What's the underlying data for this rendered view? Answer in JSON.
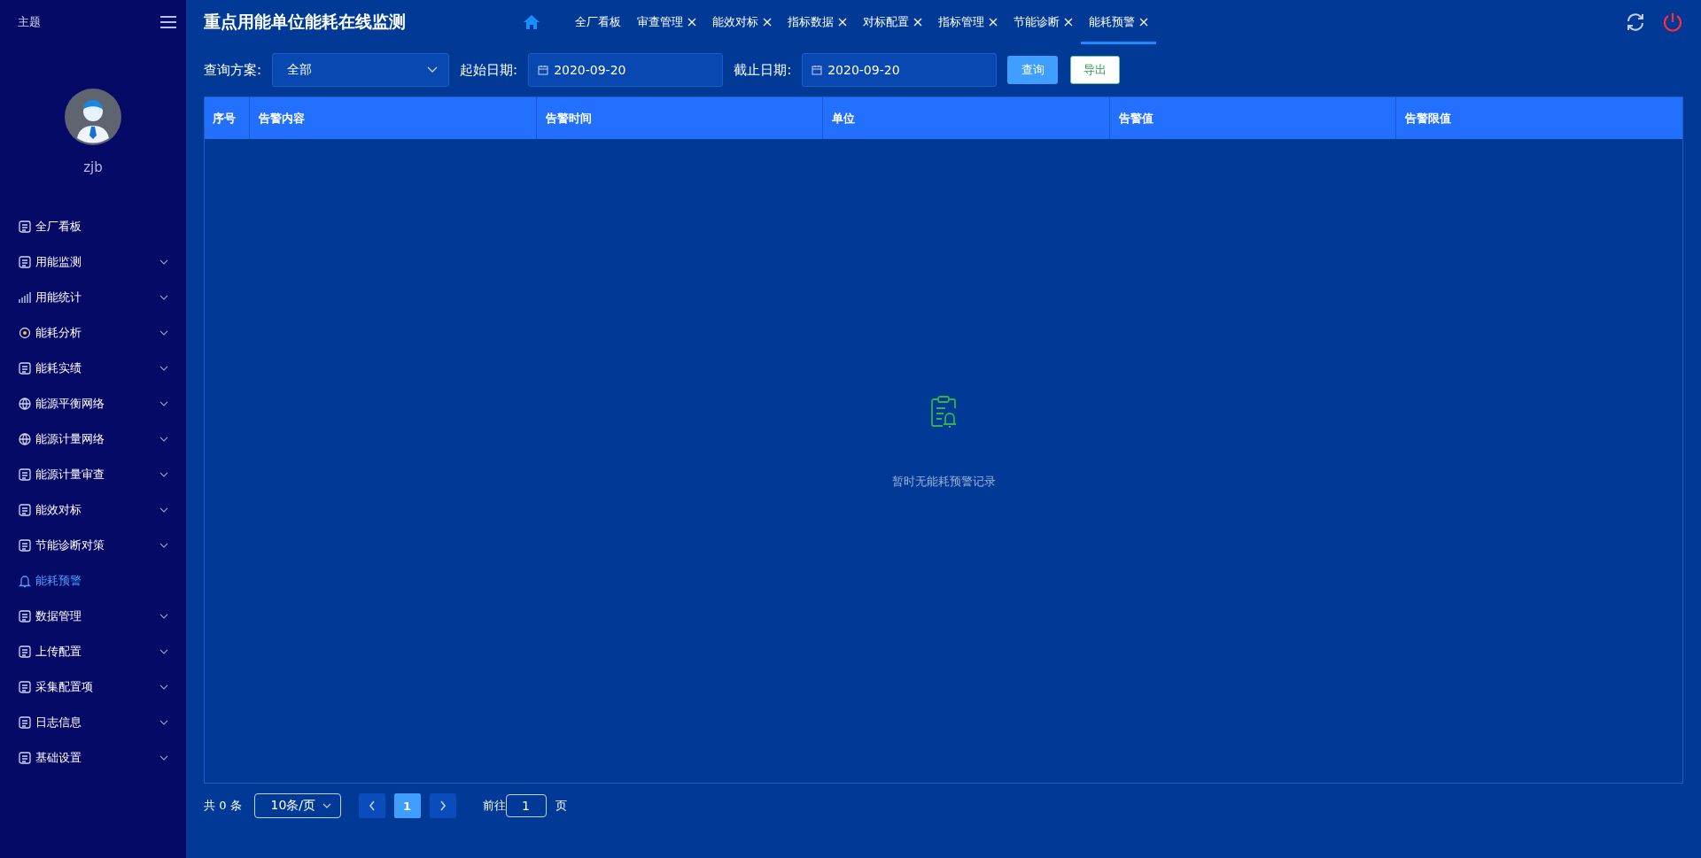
{
  "sidebar": {
    "theme_label": "主题",
    "user": {
      "name": "zjb"
    },
    "items": [
      {
        "label": "全厂看板",
        "expandable": false,
        "selected": false
      },
      {
        "label": "用能监测",
        "expandable": true,
        "selected": false
      },
      {
        "label": "用能统计",
        "expandable": true,
        "selected": false
      },
      {
        "label": "能耗分析",
        "expandable": true,
        "selected": false
      },
      {
        "label": "能耗实绩",
        "expandable": true,
        "selected": false
      },
      {
        "label": "能源平衡网络",
        "expandable": true,
        "selected": false
      },
      {
        "label": "能源计量网络",
        "expandable": true,
        "selected": false
      },
      {
        "label": "能源计量审查",
        "expandable": true,
        "selected": false
      },
      {
        "label": "能效对标",
        "expandable": true,
        "selected": false
      },
      {
        "label": "节能诊断对策",
        "expandable": true,
        "selected": false
      },
      {
        "label": "能耗预警",
        "expandable": false,
        "selected": true
      },
      {
        "label": "数据管理",
        "expandable": true,
        "selected": false
      },
      {
        "label": "上传配置",
        "expandable": true,
        "selected": false
      },
      {
        "label": "采集配置项",
        "expandable": true,
        "selected": false
      },
      {
        "label": "日志信息",
        "expandable": true,
        "selected": false
      },
      {
        "label": "基础设置",
        "expandable": true,
        "selected": false
      }
    ]
  },
  "header": {
    "title": "重点用能单位能耗在线监测",
    "tabs": [
      {
        "label": "全厂看板",
        "closable": false,
        "selected": false
      },
      {
        "label": "审查管理",
        "closable": true,
        "selected": false
      },
      {
        "label": "能效对标",
        "closable": true,
        "selected": false
      },
      {
        "label": "指标数据",
        "closable": true,
        "selected": false
      },
      {
        "label": "对标配置",
        "closable": true,
        "selected": false
      },
      {
        "label": "指标管理",
        "closable": true,
        "selected": false
      },
      {
        "label": "节能诊断",
        "closable": true,
        "selected": false
      },
      {
        "label": "能耗预警",
        "closable": true,
        "selected": true
      }
    ]
  },
  "filters": {
    "scheme_label": "查询方案:",
    "scheme_value": "全部",
    "start_label": "起始日期:",
    "start_value": "2020-09-20",
    "end_label": "截止日期:",
    "end_value": "2020-09-20",
    "query_button": "查询",
    "export_button": "导出"
  },
  "table": {
    "columns": [
      "序号",
      "告警内容",
      "告警时间",
      "单位",
      "告警值",
      "告警限值"
    ],
    "empty_text": "暂时无能耗预警记录"
  },
  "pagination": {
    "total": "共 0 条",
    "page_size": "10条/页",
    "pages": [
      {
        "label": "1",
        "selected": true
      }
    ],
    "goto_label": "前往",
    "goto_value": "1",
    "page_suffix": "页"
  }
}
